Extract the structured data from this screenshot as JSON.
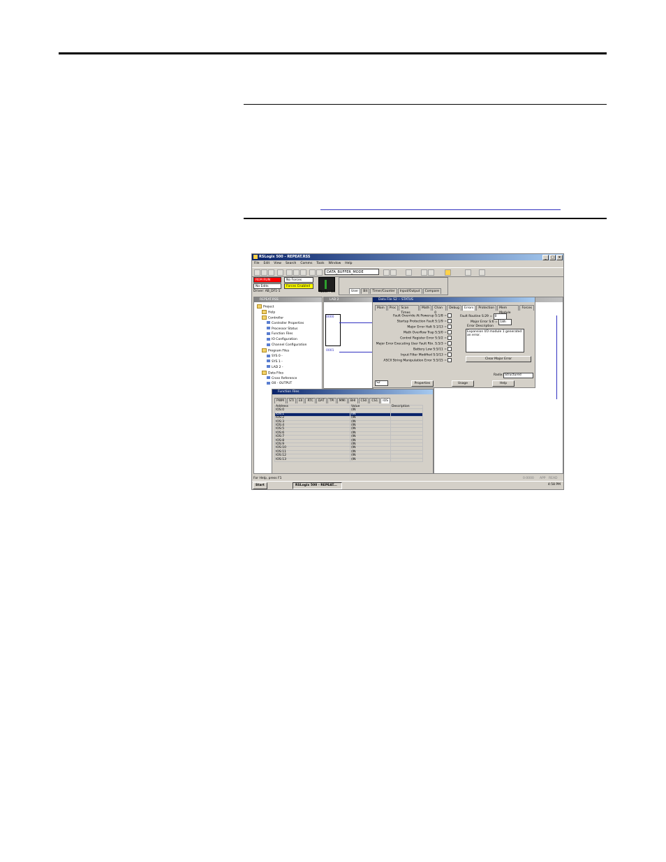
{
  "window": {
    "title": "RSLogix 500 - REPEAT.RSS",
    "menu": [
      "File",
      "Edit",
      "View",
      "Search",
      "Comms",
      "Tools",
      "Window",
      "Help"
    ],
    "combo_value": "DATA_BUFFER_MODE"
  },
  "online": {
    "mode": "REM RUN",
    "edits": "No Edits",
    "forces": "No Forces",
    "forces_enabled": "Forces Enabled",
    "driver": "Driver: AB_DF1-1",
    "node": "Node : 1d"
  },
  "instruction_tabs": [
    "User",
    "Bit",
    "Timer/Counter",
    "Input/Output",
    "Compare"
  ],
  "project_pane": {
    "title": "REPEAT.RSS",
    "tree": [
      {
        "label": "Project",
        "icon": "folder-icon",
        "indent": 0
      },
      {
        "label": "Help",
        "icon": "folder-icon",
        "indent": 1
      },
      {
        "label": "Controller",
        "icon": "folder-icon",
        "indent": 1
      },
      {
        "label": "Controller Properties",
        "icon": "doc-icon",
        "indent": 2
      },
      {
        "label": "Processor Status",
        "icon": "doc-icon",
        "indent": 2
      },
      {
        "label": "Function Files",
        "icon": "doc-icon",
        "indent": 2
      },
      {
        "label": "IO Configuration",
        "icon": "doc-icon",
        "indent": 2
      },
      {
        "label": "Channel Configuration",
        "icon": "doc-icon",
        "indent": 2
      },
      {
        "label": "Program Files",
        "icon": "folder-icon",
        "indent": 1
      },
      {
        "label": "SYS 0 -",
        "icon": "doc-icon",
        "indent": 2
      },
      {
        "label": "SYS 1 -",
        "icon": "doc-icon",
        "indent": 2
      },
      {
        "label": "LAD 2 -",
        "icon": "doc-icon",
        "indent": 2
      },
      {
        "label": "Data Files",
        "icon": "folder-icon",
        "indent": 1
      },
      {
        "label": "Cross Reference",
        "icon": "doc-icon",
        "indent": 2
      },
      {
        "label": "O0 - OUTPUT",
        "icon": "doc-icon",
        "indent": 2
      }
    ]
  },
  "ladder_pane": {
    "title": "LAD 2",
    "rungs": [
      "0000",
      "0001"
    ]
  },
  "status_dialog": {
    "title": "Data File S2 -- STATUS",
    "tabs": [
      "Main",
      "Proc",
      "Scan Times",
      "Math",
      "Chan 0",
      "Debug",
      "Errors",
      "Protection",
      "Mem Module",
      "Forces"
    ],
    "active_tab": "Errors",
    "left_fields": [
      "Fault Override At Powerup S:1/8 =",
      "Startup Protection Fault S:1/9 =",
      "Major Error Halt S:1/13 =",
      "Math Overflow Trap S:5/0 =",
      "Control Register Error S:5/2 =",
      "Major Error Executing User Fault Rtn. S:5/3 =",
      "Battery Low S:5/11 =",
      "Input Filter Modified S:5/13 =",
      "ASCII String Manipulation Error S:5/15 ="
    ],
    "fault_routine_label": "Fault Routine S:29 =",
    "fault_routine_value": "0",
    "major_error_label": "Major Error S:6 =",
    "major_error_value": "18h",
    "error_desc_label": "Error Description",
    "error_desc": "Expansion I/O module 1 generated an error.",
    "clear_button": "Clear Major Error",
    "address": "S2",
    "buttons": [
      "Properties",
      "Usage",
      "Help"
    ],
    "radix_label": "Radix:",
    "radix_value": "Structured"
  },
  "function_files": {
    "title": "Function Files",
    "tabs": [
      "PWM",
      "STI",
      "EII",
      "RTC",
      "DAT",
      "TPI",
      "MMI",
      "BHI",
      "CS0",
      "CS1",
      "IOS"
    ],
    "active_tab": "IOS",
    "columns": [
      "Address",
      "Value",
      "Description"
    ],
    "rows": [
      [
        "IOS:0",
        "(IN",
        ""
      ],
      [
        "IOS:1",
        "(IN",
        ""
      ],
      [
        "IOS:2",
        "(IN",
        ""
      ],
      [
        "IOS:3",
        "(IN",
        ""
      ],
      [
        "IOS:4",
        "(IN",
        ""
      ],
      [
        "IOS:5",
        "(IN",
        ""
      ],
      [
        "IOS:6",
        "(IN",
        ""
      ],
      [
        "IOS:7",
        "(IN",
        ""
      ],
      [
        "IOS:8",
        "(IN",
        ""
      ],
      [
        "IOS:9",
        "(IN",
        ""
      ],
      [
        "IOS:10",
        "(IN",
        ""
      ],
      [
        "IOS:11",
        "(IN",
        ""
      ],
      [
        "IOS:12",
        "(IN",
        ""
      ],
      [
        "IOS:13",
        "(IN",
        ""
      ]
    ],
    "selected_row": 1
  },
  "status_bar": {
    "help": "For Help, press F1",
    "fields": [
      "0:0000",
      "APP",
      "READ"
    ]
  },
  "taskbar": {
    "start": "Start",
    "task": "RSLogix 500 - REPEAT...",
    "clock": "4:58 PM"
  },
  "colors": {
    "mode_red": "#ff0000",
    "forces_yellow": "#ffff00",
    "titlebar": "#0a246a",
    "link": "#3030c0"
  }
}
